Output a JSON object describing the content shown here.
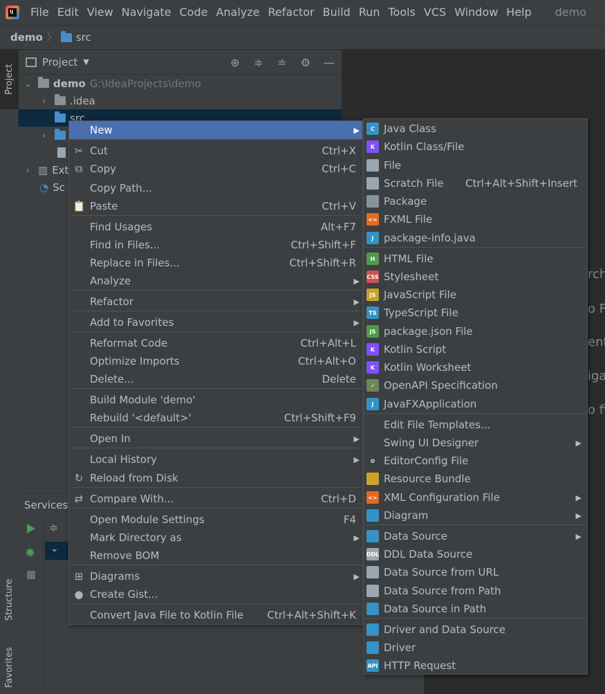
{
  "menubar": {
    "items": [
      "File",
      "Edit",
      "View",
      "Navigate",
      "Code",
      "Analyze",
      "Refactor",
      "Build",
      "Run",
      "Tools",
      "VCS",
      "Window",
      "Help"
    ],
    "title": "demo"
  },
  "breadcrumb": {
    "root": "demo",
    "child": "src"
  },
  "left_strip": {
    "project": "Project",
    "structure": "Structure",
    "favorites": "Favorites"
  },
  "project_panel": {
    "title": "Project",
    "tree": {
      "root_name": "demo",
      "root_path": "G:\\IdeaProjects\\demo",
      "idea": ".idea",
      "src": "src",
      "ext": "Ext",
      "sc": "Sc"
    }
  },
  "services": {
    "title": "Services"
  },
  "editor_hints": [
    "rch",
    "o F",
    "ent",
    "iga",
    "o fi"
  ],
  "context_menu": {
    "items": [
      {
        "label": "New",
        "shortcut": "",
        "submenu": true,
        "icon": ""
      },
      {
        "label": "Cut",
        "shortcut": "Ctrl+X",
        "submenu": false,
        "icon": "scissors-icon"
      },
      {
        "label": "Copy",
        "shortcut": "Ctrl+C",
        "submenu": false,
        "icon": "copy-icon"
      },
      {
        "label": "Copy Path...",
        "shortcut": "",
        "submenu": false,
        "icon": ""
      },
      {
        "label": "Paste",
        "shortcut": "Ctrl+V",
        "submenu": false,
        "icon": "paste-icon"
      },
      {
        "label": "Find Usages",
        "shortcut": "Alt+F7",
        "submenu": false,
        "icon": ""
      },
      {
        "label": "Find in Files...",
        "shortcut": "Ctrl+Shift+F",
        "submenu": false,
        "icon": ""
      },
      {
        "label": "Replace in Files...",
        "shortcut": "Ctrl+Shift+R",
        "submenu": false,
        "icon": ""
      },
      {
        "label": "Analyze",
        "shortcut": "",
        "submenu": true,
        "icon": ""
      },
      {
        "label": "Refactor",
        "shortcut": "",
        "submenu": true,
        "icon": ""
      },
      {
        "label": "Add to Favorites",
        "shortcut": "",
        "submenu": true,
        "icon": ""
      },
      {
        "label": "Reformat Code",
        "shortcut": "Ctrl+Alt+L",
        "submenu": false,
        "icon": ""
      },
      {
        "label": "Optimize Imports",
        "shortcut": "Ctrl+Alt+O",
        "submenu": false,
        "icon": ""
      },
      {
        "label": "Delete...",
        "shortcut": "Delete",
        "submenu": false,
        "icon": ""
      },
      {
        "label": "Build Module 'demo'",
        "shortcut": "",
        "submenu": false,
        "icon": ""
      },
      {
        "label": "Rebuild '<default>'",
        "shortcut": "Ctrl+Shift+F9",
        "submenu": false,
        "icon": ""
      },
      {
        "label": "Open In",
        "shortcut": "",
        "submenu": true,
        "icon": ""
      },
      {
        "label": "Local History",
        "shortcut": "",
        "submenu": true,
        "icon": ""
      },
      {
        "label": "Reload from Disk",
        "shortcut": "",
        "submenu": false,
        "icon": "reload-icon"
      },
      {
        "label": "Compare With...",
        "shortcut": "Ctrl+D",
        "submenu": false,
        "icon": "compare-icon"
      },
      {
        "label": "Open Module Settings",
        "shortcut": "F4",
        "submenu": false,
        "icon": ""
      },
      {
        "label": "Mark Directory as",
        "shortcut": "",
        "submenu": true,
        "icon": ""
      },
      {
        "label": "Remove BOM",
        "shortcut": "",
        "submenu": false,
        "icon": ""
      },
      {
        "label": "Diagrams",
        "shortcut": "",
        "submenu": true,
        "icon": "diagram-icon"
      },
      {
        "label": "Create Gist...",
        "shortcut": "",
        "submenu": false,
        "icon": "github-icon"
      },
      {
        "label": "Convert Java File to Kotlin File",
        "shortcut": "Ctrl+Alt+Shift+K",
        "submenu": false,
        "icon": ""
      }
    ]
  },
  "new_submenu": {
    "items": [
      {
        "label": "Java Class",
        "shortcut": "",
        "submenu": false,
        "icon": "java-class-icon",
        "icon_text": "C",
        "color": "#3592c4"
      },
      {
        "label": "Kotlin Class/File",
        "shortcut": "",
        "submenu": false,
        "icon": "kotlin-icon",
        "icon_text": "K",
        "color": "#7f52ff"
      },
      {
        "label": "File",
        "shortcut": "",
        "submenu": false,
        "icon": "file-icon",
        "icon_text": "",
        "color": "#9aa7b0"
      },
      {
        "label": "Scratch File",
        "shortcut": "Ctrl+Alt+Shift+Insert",
        "submenu": false,
        "icon": "scratch-file-icon",
        "icon_text": "",
        "color": "#9aa7b0"
      },
      {
        "label": "Package",
        "shortcut": "",
        "submenu": false,
        "icon": "package-icon",
        "icon_text": "",
        "color": "#87939a"
      },
      {
        "label": "FXML File",
        "shortcut": "",
        "submenu": false,
        "icon": "fxml-icon",
        "icon_text": "<>",
        "color": "#e06c1f"
      },
      {
        "label": "package-info.java",
        "shortcut": "",
        "submenu": false,
        "icon": "java-file-icon",
        "icon_text": "J",
        "color": "#3592c4"
      },
      {
        "label": "HTML File",
        "shortcut": "",
        "submenu": false,
        "icon": "html-icon",
        "icon_text": "H",
        "color": "#4f9b4a"
      },
      {
        "label": "Stylesheet",
        "shortcut": "",
        "submenu": false,
        "icon": "css-icon",
        "icon_text": "CSS",
        "color": "#c75450"
      },
      {
        "label": "JavaScript File",
        "shortcut": "",
        "submenu": false,
        "icon": "javascript-icon",
        "icon_text": "JS",
        "color": "#c9a32a"
      },
      {
        "label": "TypeScript File",
        "shortcut": "",
        "submenu": false,
        "icon": "typescript-icon",
        "icon_text": "TS",
        "color": "#3592c4"
      },
      {
        "label": "package.json File",
        "shortcut": "",
        "submenu": false,
        "icon": "nodejs-icon",
        "icon_text": "JS",
        "color": "#4f9b4a"
      },
      {
        "label": "Kotlin Script",
        "shortcut": "",
        "submenu": false,
        "icon": "kotlin-script-icon",
        "icon_text": "K",
        "color": "#7f52ff"
      },
      {
        "label": "Kotlin Worksheet",
        "shortcut": "",
        "submenu": false,
        "icon": "kotlin-worksheet-icon",
        "icon_text": "K",
        "color": "#7f52ff"
      },
      {
        "label": "OpenAPI Specification",
        "shortcut": "",
        "submenu": false,
        "icon": "openapi-icon",
        "icon_text": "✓",
        "color": "#6a8759"
      },
      {
        "label": "JavaFXApplication",
        "shortcut": "",
        "submenu": false,
        "icon": "javafx-icon",
        "icon_text": "J",
        "color": "#3592c4"
      },
      {
        "label": "Edit File Templates...",
        "shortcut": "",
        "submenu": false,
        "icon": "",
        "icon_text": "",
        "color": ""
      },
      {
        "label": "Swing UI Designer",
        "shortcut": "",
        "submenu": true,
        "icon": "",
        "icon_text": "",
        "color": ""
      },
      {
        "label": "EditorConfig File",
        "shortcut": "",
        "submenu": false,
        "icon": "gear-icon",
        "icon_text": "⚙",
        "color": "#3c3f41"
      },
      {
        "label": "Resource Bundle",
        "shortcut": "",
        "submenu": false,
        "icon": "resource-bundle-icon",
        "icon_text": "",
        "color": "#c9a32a"
      },
      {
        "label": "XML Configuration File",
        "shortcut": "",
        "submenu": true,
        "icon": "xml-icon",
        "icon_text": "<>",
        "color": "#e06c1f"
      },
      {
        "label": "Diagram",
        "shortcut": "",
        "submenu": true,
        "icon": "diagram-icon",
        "icon_text": "",
        "color": "#3592c4"
      },
      {
        "label": "Data Source",
        "shortcut": "",
        "submenu": true,
        "icon": "database-icon",
        "icon_text": "",
        "color": "#3592c4"
      },
      {
        "label": "DDL Data Source",
        "shortcut": "",
        "submenu": false,
        "icon": "ddl-icon",
        "icon_text": "DDL",
        "color": "#9aa7b0"
      },
      {
        "label": "Data Source from URL",
        "shortcut": "",
        "submenu": false,
        "icon": "url-icon",
        "icon_text": "",
        "color": "#9aa7b0"
      },
      {
        "label": "Data Source from Path",
        "shortcut": "",
        "submenu": false,
        "icon": "folder-icon",
        "icon_text": "",
        "color": "#9aa7b0"
      },
      {
        "label": "Data Source in Path",
        "shortcut": "",
        "submenu": false,
        "icon": "database-icon",
        "icon_text": "",
        "color": "#3592c4"
      },
      {
        "label": "Driver and Data Source",
        "shortcut": "",
        "submenu": false,
        "icon": "driver-icon",
        "icon_text": "",
        "color": "#3592c4"
      },
      {
        "label": "Driver",
        "shortcut": "",
        "submenu": false,
        "icon": "driver-icon",
        "icon_text": "",
        "color": "#3592c4"
      },
      {
        "label": "HTTP Request",
        "shortcut": "",
        "submenu": false,
        "icon": "api-icon",
        "icon_text": "API",
        "color": "#3592c4"
      }
    ]
  }
}
